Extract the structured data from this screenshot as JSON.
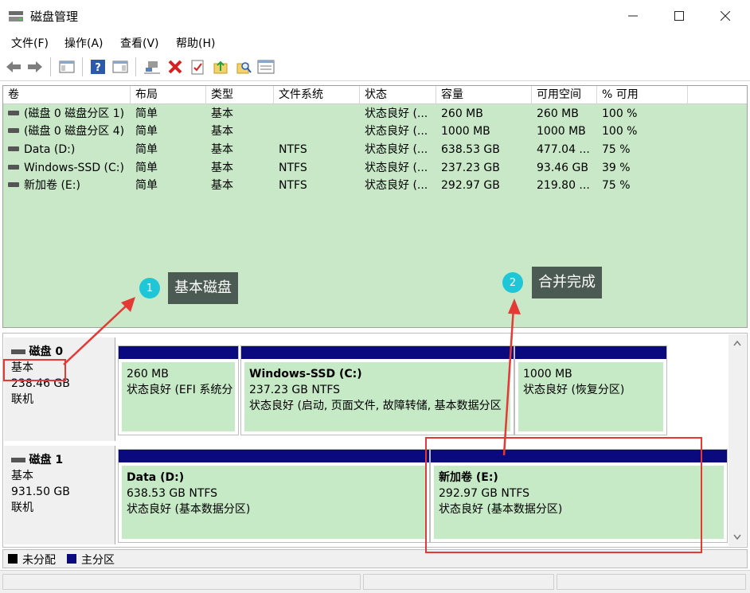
{
  "window": {
    "title": "磁盘管理"
  },
  "menu": [
    "文件(F)",
    "操作(A)",
    "查看(V)",
    "帮助(H)"
  ],
  "columns": [
    "卷",
    "布局",
    "类型",
    "文件系统",
    "状态",
    "容量",
    "可用空间",
    "% 可用"
  ],
  "volumes": [
    {
      "name": "(磁盘 0 磁盘分区 1)",
      "layout": "简单",
      "type": "基本",
      "fs": "",
      "status": "状态良好 (...",
      "capacity": "260 MB",
      "free": "260 MB",
      "pct": "100 %"
    },
    {
      "name": "(磁盘 0 磁盘分区 4)",
      "layout": "简单",
      "type": "基本",
      "fs": "",
      "status": "状态良好 (...",
      "capacity": "1000 MB",
      "free": "1000 MB",
      "pct": "100 %"
    },
    {
      "name": "Data (D:)",
      "layout": "简单",
      "type": "基本",
      "fs": "NTFS",
      "status": "状态良好 (...",
      "capacity": "638.53 GB",
      "free": "477.04 ...",
      "pct": "75 %"
    },
    {
      "name": "Windows-SSD (C:)",
      "layout": "简单",
      "type": "基本",
      "fs": "NTFS",
      "status": "状态良好 (...",
      "capacity": "237.23 GB",
      "free": "93.46 GB",
      "pct": "39 %"
    },
    {
      "name": "新加卷 (E:)",
      "layout": "简单",
      "type": "基本",
      "fs": "NTFS",
      "status": "状态良好 (...",
      "capacity": "292.97 GB",
      "free": "219.80 ...",
      "pct": "75 %"
    }
  ],
  "callouts": [
    {
      "num": "1",
      "text": "基本磁盘"
    },
    {
      "num": "2",
      "text": "合并完成"
    }
  ],
  "disks": [
    {
      "name": "磁盘 0",
      "type": "基本",
      "size": "238.46 GB",
      "state": "联机",
      "partitions": [
        {
          "title": "",
          "size": "260 MB",
          "status": "状态良好 (EFI 系统分"
        },
        {
          "title": "Windows-SSD  (C:)",
          "size": "237.23 GB NTFS",
          "status": "状态良好 (启动, 页面文件, 故障转储, 基本数据分区"
        },
        {
          "title": "",
          "size": "1000 MB",
          "status": "状态良好 (恢复分区)"
        }
      ]
    },
    {
      "name": "磁盘 1",
      "type": "基本",
      "size": "931.50 GB",
      "state": "联机",
      "partitions": [
        {
          "title": "Data  (D:)",
          "size": "638.53 GB NTFS",
          "status": "状态良好 (基本数据分区)"
        },
        {
          "title": "新加卷  (E:)",
          "size": "292.97 GB NTFS",
          "status": "状态良好 (基本数据分区)"
        }
      ]
    }
  ],
  "legend": [
    {
      "label": "未分配",
      "color": "#000000"
    },
    {
      "label": "主分区",
      "color": "#0a0a7e"
    }
  ]
}
